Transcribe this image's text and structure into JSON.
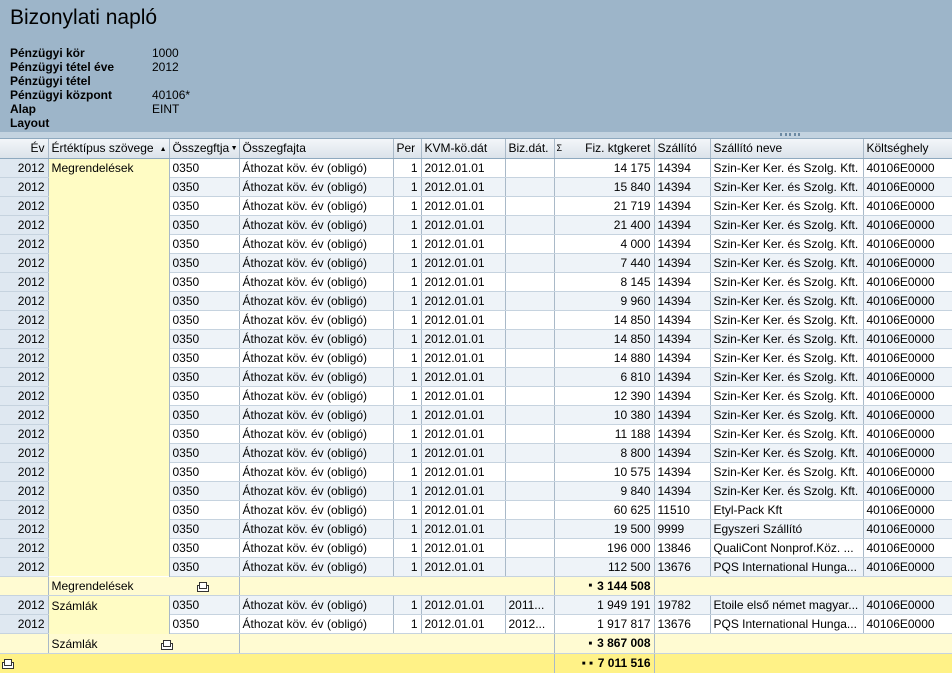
{
  "title": "Bizonylati napló",
  "params": [
    {
      "label": "Pénzügyi kör",
      "value": "1000"
    },
    {
      "label": "Pénzügyi tétel éve",
      "value": "2012"
    },
    {
      "label": "Pénzügyi tétel",
      "value": ""
    },
    {
      "label": "Pénzügyi központ",
      "value": "40106*"
    },
    {
      "label": "Alap",
      "value": "EINT"
    },
    {
      "label": "Layout",
      "value": ""
    }
  ],
  "columns": [
    "Év",
    "Értéktípus szövege",
    "Összegftja",
    "Összegfajta",
    "Per",
    "KVM-kö.dát",
    "Biz.dát.",
    "Fiz. ktgkeret",
    "Szállító",
    "Szállító neve",
    "Költséghely"
  ],
  "groups": [
    {
      "name": "Megrendelések",
      "rows": [
        [
          "2012",
          "0350",
          "Áthozat köv. év    (obligó)",
          "1",
          "2012.01.01",
          "",
          "14 175",
          "14394",
          "Szin-Ker Ker. és Szolg. Kft.",
          "40106E0000"
        ],
        [
          "2012",
          "0350",
          "Áthozat köv. év    (obligó)",
          "1",
          "2012.01.01",
          "",
          "15 840",
          "14394",
          "Szin-Ker Ker. és Szolg. Kft.",
          "40106E0000"
        ],
        [
          "2012",
          "0350",
          "Áthozat köv. év    (obligó)",
          "1",
          "2012.01.01",
          "",
          "21 719",
          "14394",
          "Szin-Ker Ker. és Szolg. Kft.",
          "40106E0000"
        ],
        [
          "2012",
          "0350",
          "Áthozat köv. év    (obligó)",
          "1",
          "2012.01.01",
          "",
          "21 400",
          "14394",
          "Szin-Ker Ker. és Szolg. Kft.",
          "40106E0000"
        ],
        [
          "2012",
          "0350",
          "Áthozat köv. év    (obligó)",
          "1",
          "2012.01.01",
          "",
          "4 000",
          "14394",
          "Szin-Ker Ker. és Szolg. Kft.",
          "40106E0000"
        ],
        [
          "2012",
          "0350",
          "Áthozat köv. év    (obligó)",
          "1",
          "2012.01.01",
          "",
          "7 440",
          "14394",
          "Szin-Ker Ker. és Szolg. Kft.",
          "40106E0000"
        ],
        [
          "2012",
          "0350",
          "Áthozat köv. év    (obligó)",
          "1",
          "2012.01.01",
          "",
          "8 145",
          "14394",
          "Szin-Ker Ker. és Szolg. Kft.",
          "40106E0000"
        ],
        [
          "2012",
          "0350",
          "Áthozat köv. év    (obligó)",
          "1",
          "2012.01.01",
          "",
          "9 960",
          "14394",
          "Szin-Ker Ker. és Szolg. Kft.",
          "40106E0000"
        ],
        [
          "2012",
          "0350",
          "Áthozat köv. év    (obligó)",
          "1",
          "2012.01.01",
          "",
          "14 850",
          "14394",
          "Szin-Ker Ker. és Szolg. Kft.",
          "40106E0000"
        ],
        [
          "2012",
          "0350",
          "Áthozat köv. év    (obligó)",
          "1",
          "2012.01.01",
          "",
          "14 850",
          "14394",
          "Szin-Ker Ker. és Szolg. Kft.",
          "40106E0000"
        ],
        [
          "2012",
          "0350",
          "Áthozat köv. év    (obligó)",
          "1",
          "2012.01.01",
          "",
          "14 880",
          "14394",
          "Szin-Ker Ker. és Szolg. Kft.",
          "40106E0000"
        ],
        [
          "2012",
          "0350",
          "Áthozat köv. év    (obligó)",
          "1",
          "2012.01.01",
          "",
          "6 810",
          "14394",
          "Szin-Ker Ker. és Szolg. Kft.",
          "40106E0000"
        ],
        [
          "2012",
          "0350",
          "Áthozat köv. év    (obligó)",
          "1",
          "2012.01.01",
          "",
          "12 390",
          "14394",
          "Szin-Ker Ker. és Szolg. Kft.",
          "40106E0000"
        ],
        [
          "2012",
          "0350",
          "Áthozat köv. év    (obligó)",
          "1",
          "2012.01.01",
          "",
          "10 380",
          "14394",
          "Szin-Ker Ker. és Szolg. Kft.",
          "40106E0000"
        ],
        [
          "2012",
          "0350",
          "Áthozat köv. év    (obligó)",
          "1",
          "2012.01.01",
          "",
          "11 188",
          "14394",
          "Szin-Ker Ker. és Szolg. Kft.",
          "40106E0000"
        ],
        [
          "2012",
          "0350",
          "Áthozat köv. év    (obligó)",
          "1",
          "2012.01.01",
          "",
          "8 800",
          "14394",
          "Szin-Ker Ker. és Szolg. Kft.",
          "40106E0000"
        ],
        [
          "2012",
          "0350",
          "Áthozat köv. év    (obligó)",
          "1",
          "2012.01.01",
          "",
          "10 575",
          "14394",
          "Szin-Ker Ker. és Szolg. Kft.",
          "40106E0000"
        ],
        [
          "2012",
          "0350",
          "Áthozat köv. év    (obligó)",
          "1",
          "2012.01.01",
          "",
          "9 840",
          "14394",
          "Szin-Ker Ker. és Szolg. Kft.",
          "40106E0000"
        ],
        [
          "2012",
          "0350",
          "Áthozat köv. év    (obligó)",
          "1",
          "2012.01.01",
          "",
          "60 625",
          "11510",
          "Etyl-Pack Kft",
          "40106E0000"
        ],
        [
          "2012",
          "0350",
          "Áthozat köv. év    (obligó)",
          "1",
          "2012.01.01",
          "",
          "19 500",
          "9999",
          "Egyszeri Szállító",
          "40106E0000"
        ],
        [
          "2012",
          "0350",
          "Áthozat köv. év    (obligó)",
          "1",
          "2012.01.01",
          "",
          "196 000",
          "13846",
          "QualiCont  Nonprof.Köz. ...",
          "40106E0000"
        ],
        [
          "2012",
          "0350",
          "Áthozat köv. év    (obligó)",
          "1",
          "2012.01.01",
          "",
          "112 500",
          "13676",
          "PQS  International Hunga...",
          "40106E0000"
        ]
      ],
      "subtotal": "3 144 508"
    },
    {
      "name": "Számlák",
      "rows": [
        [
          "2012",
          "0350",
          "Áthozat köv. év    (obligó)",
          "1",
          "2012.01.01",
          "2011...",
          "1 949 191",
          "19782",
          "Etoile első német magyar...",
          "40106E0000"
        ],
        [
          "2012",
          "0350",
          "Áthozat köv. év    (obligó)",
          "1",
          "2012.01.01",
          "2012...",
          "1 917 817",
          "13676",
          "PQS  International Hunga...",
          "40106E0000"
        ]
      ],
      "subtotal": "3 867 008"
    }
  ],
  "total": "7 011 516",
  "icons": {
    "subtotal_marker": "sum-dots-icon",
    "print": "printer-icon",
    "sort_asc": "sort-ascending-icon",
    "sort_desc": "sort-descending-icon"
  },
  "colors": {
    "header_bg": "#9db5c9",
    "group_bg": "#fffcc4",
    "total_bg": "#fff287"
  }
}
